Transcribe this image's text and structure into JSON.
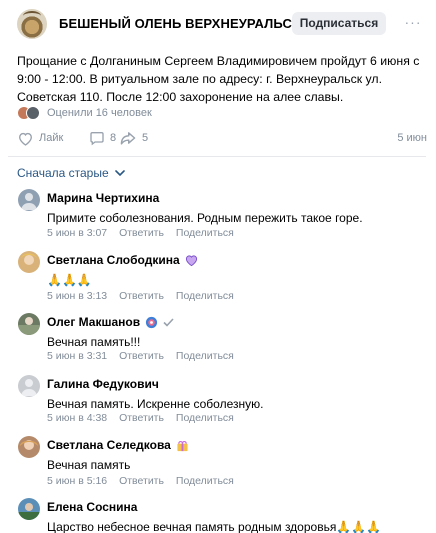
{
  "group": {
    "name": "БЕШЕНЫЙ ОЛЕНЬ ВЕРХНЕУРАЛЬСК",
    "subscribe_label": "Подписаться",
    "more_label": "···"
  },
  "post": {
    "text": "Прощание с Долганиным Сергеем Владимировичем пройдут 6 июня с 9:00 - 12:00. В ритуальном зале по адресу: г. Верхнеуральск ул. Советская 110. После 12:00 захоронение на алее славы.",
    "rated_by": "Оценили 16 человек",
    "like_label": "Лайк",
    "comments_count": "8",
    "shares_count": "5",
    "time": "5 июн"
  },
  "sort_label": "Сначала старые",
  "reply_label": "Ответить",
  "share_label": "Поделиться",
  "comments": [
    {
      "author": "Марина Чертихина",
      "text": "Примите соболезнования. Родным пережить такое горе.",
      "time": "5 июн в 3:07",
      "avatar_color": "#8fa0b3"
    },
    {
      "author": "Светлана Слободкина",
      "text": "🙏🙏🙏",
      "time": "5 июн в 3:13",
      "avatar_color": "#d9b27a"
    },
    {
      "author": "Олег Макшанов",
      "text": "Вечная память!!!",
      "time": "5 июн в 3:31",
      "avatar_color": "#6d7a63"
    },
    {
      "author": "Галина Федукович",
      "text": "Вечная память. Искренне соболезную.",
      "time": "5 июн в 4:38",
      "avatar_color": "#c9ccd1"
    },
    {
      "author": "Светлана Селедкова",
      "text": "Вечная память",
      "time": "5 июн в 5:16",
      "avatar_color": "#b58a6a"
    },
    {
      "author": "Елена Соснина",
      "text": "Царство небесное вечная память родным здоровья🙏🙏🙏",
      "time": "",
      "avatar_color": "#5b8fb8"
    }
  ]
}
